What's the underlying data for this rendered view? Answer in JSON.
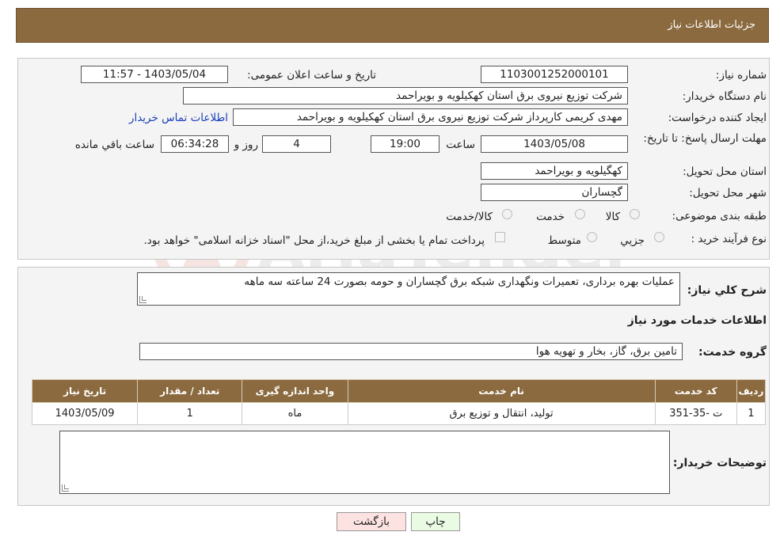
{
  "header": {
    "title": "جزئیات اطلاعات نیاز"
  },
  "fields": {
    "need_number_label": "شماره نیاز:",
    "need_number": "1103001252000101",
    "announce_label": "تاریخ و ساعت اعلان عمومی:",
    "announce_value": "1403/05/04 - 11:57",
    "buyer_org_label": "نام دستگاه خریدار:",
    "buyer_org": "شرکت توزیع نیروی برق استان کهکیلویه و بویراحمد",
    "creator_label": "ایجاد کننده درخواست:",
    "creator": "مهدی کریمی کارپرداز شرکت توزیع نیروی برق استان کهکیلویه و بویراحمد",
    "contact_link": "اطلاعات تماس خریدار",
    "deadline_label": "مهلت ارسال پاسخ: تا تاریخ:",
    "deadline_date": "1403/05/08",
    "time_label": "ساعت",
    "deadline_time": "19:00",
    "days": "4",
    "days_label": "روز و",
    "remaining": "06:34:28",
    "remaining_label": "ساعت باقي مانده",
    "province_label": "استان محل تحویل:",
    "province": "کهگیلویه و بویراحمد",
    "city_label": "شهر محل تحویل:",
    "city": "گچساران",
    "category_label": "طبقه بندی موضوعی:",
    "cat_goods": "کالا",
    "cat_service": "خدمت",
    "cat_goods_service": "کالا/خدمت",
    "process_label": "نوع فرآیند خرید :",
    "proc_partial": "جزیي",
    "proc_medium": "متوسط",
    "payment_note": "پرداخت تمام یا بخشی از مبلغ خرید،از محل \"اسناد خزانه اسلامی\" خواهد بود."
  },
  "summary": {
    "label": "شرح کلي نیاز:",
    "text": "عملیات بهره برداری، تعمیرات ونگهداری شبکه برق گچساران و حومه بصورت 24 ساعته سه ماهه",
    "services_title": "اطلاعات خدمات مورد نیاز",
    "group_label": "گروه خدمت:",
    "group_value": "تامین برق، گاز، بخار و تهویه هوا"
  },
  "table": {
    "headers": [
      "ردیف",
      "کد خدمت",
      "نام خدمت",
      "واحد اندازه گیری",
      "تعداد / مقدار",
      "تاریخ نیاز"
    ],
    "rows": [
      [
        "1",
        "ت -35-351",
        "تولید، انتقال و توزیع برق",
        "ماه",
        "1",
        "1403/05/09"
      ]
    ]
  },
  "buyer_notes": {
    "label": "توضیحات خریدار:",
    "text": ""
  },
  "buttons": {
    "print": "چاپ",
    "back": "بازگشت"
  },
  "colors": {
    "header_bg": "#8b6a3f",
    "link": "#1a3fb8",
    "print_bg": "#eafbe4",
    "back_bg": "#fde2e2"
  }
}
